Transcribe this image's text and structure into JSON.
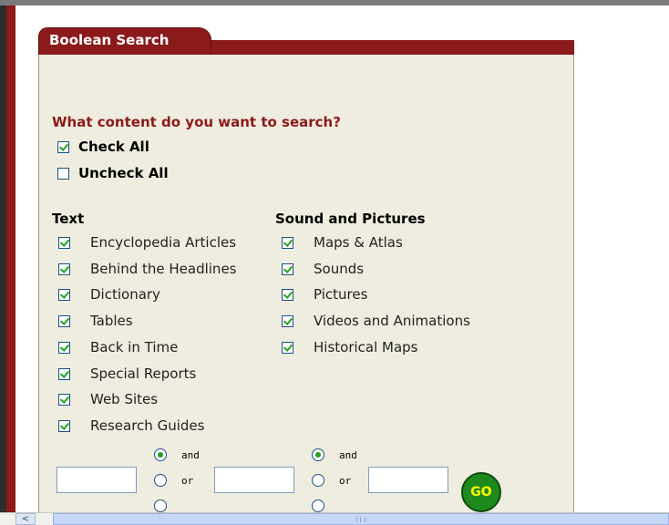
{
  "tab": {
    "title": "Boolean Search"
  },
  "content_question": "What content do you want to search?",
  "check_all": {
    "label": "Check All",
    "checked": true
  },
  "uncheck_all": {
    "label": "Uncheck All",
    "checked": false
  },
  "text_column": {
    "header": "Text",
    "items": [
      {
        "label": "Encyclopedia Articles",
        "checked": true
      },
      {
        "label": "Behind the Headlines",
        "checked": true
      },
      {
        "label": "Dictionary",
        "checked": true
      },
      {
        "label": "Tables",
        "checked": true
      },
      {
        "label": "Back in Time",
        "checked": true
      },
      {
        "label": "Special Reports",
        "checked": true
      },
      {
        "label": "Web Sites",
        "checked": true
      },
      {
        "label": "Research Guides",
        "checked": true
      }
    ]
  },
  "media_column": {
    "header": "Sound and Pictures",
    "items": [
      {
        "label": "Maps & Atlas",
        "checked": true
      },
      {
        "label": "Sounds",
        "checked": true
      },
      {
        "label": "Pictures",
        "checked": true
      },
      {
        "label": "Videos and Animations",
        "checked": true
      },
      {
        "label": "Historical Maps",
        "checked": true
      }
    ]
  },
  "boolean": {
    "inputs": [
      {
        "value": "",
        "placeholder": ""
      },
      {
        "value": "",
        "placeholder": ""
      },
      {
        "value": "",
        "placeholder": ""
      }
    ],
    "operators_1": {
      "and": "and",
      "or": "or",
      "selected": "and"
    },
    "operators_2": {
      "and": "and",
      "or": "or",
      "selected": "and"
    }
  },
  "go_button": {
    "label": "GO"
  },
  "scrollbar": {
    "left_arrow": "<"
  },
  "colors": {
    "accent": "#8b1a1a",
    "panel_bg": "#efede0",
    "check_green": "#21a121",
    "go_green": "#1e8a1e",
    "go_text": "#ffff00"
  }
}
